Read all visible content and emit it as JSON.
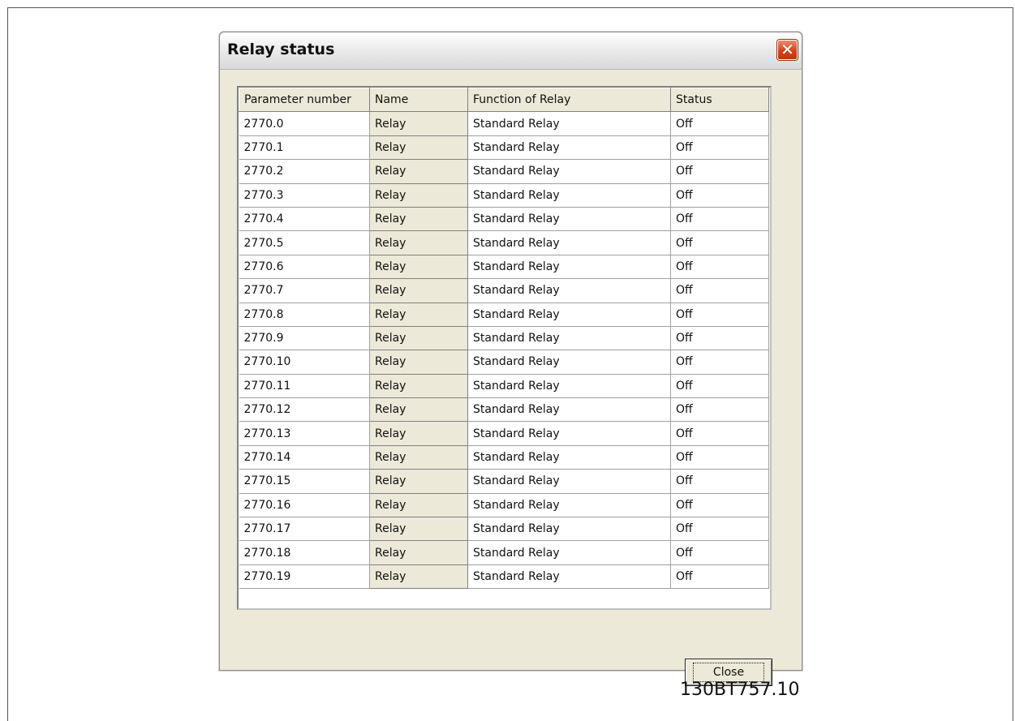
{
  "window": {
    "title": "Relay status",
    "close_glyph": "✕"
  },
  "table": {
    "headers": [
      "Parameter number",
      "Name",
      "Function of Relay",
      "Status"
    ],
    "rows": [
      [
        "2770.0",
        "Relay",
        "Standard Relay",
        "Off"
      ],
      [
        "2770.1",
        "Relay",
        "Standard Relay",
        "Off"
      ],
      [
        "2770.2",
        "Relay",
        "Standard Relay",
        "Off"
      ],
      [
        "2770.3",
        "Relay",
        "Standard Relay",
        "Off"
      ],
      [
        "2770.4",
        "Relay",
        "Standard Relay",
        "Off"
      ],
      [
        "2770.5",
        "Relay",
        "Standard Relay",
        "Off"
      ],
      [
        "2770.6",
        "Relay",
        "Standard Relay",
        "Off"
      ],
      [
        "2770.7",
        "Relay",
        "Standard Relay",
        "Off"
      ],
      [
        "2770.8",
        "Relay",
        "Standard Relay",
        "Off"
      ],
      [
        "2770.9",
        "Relay",
        "Standard Relay",
        "Off"
      ],
      [
        "2770.10",
        "Relay",
        "Standard Relay",
        "Off"
      ],
      [
        "2770.11",
        "Relay",
        "Standard Relay",
        "Off"
      ],
      [
        "2770.12",
        "Relay",
        "Standard Relay",
        "Off"
      ],
      [
        "2770.13",
        "Relay",
        "Standard Relay",
        "Off"
      ],
      [
        "2770.14",
        "Relay",
        "Standard Relay",
        "Off"
      ],
      [
        "2770.15",
        "Relay",
        "Standard Relay",
        "Off"
      ],
      [
        "2770.16",
        "Relay",
        "Standard Relay",
        "Off"
      ],
      [
        "2770.17",
        "Relay",
        "Standard Relay",
        "Off"
      ],
      [
        "2770.18",
        "Relay",
        "Standard Relay",
        "Off"
      ],
      [
        "2770.19",
        "Relay",
        "Standard Relay",
        "Off"
      ]
    ]
  },
  "buttons": {
    "close_label": "Close"
  },
  "figure_code": "130BT757.10"
}
